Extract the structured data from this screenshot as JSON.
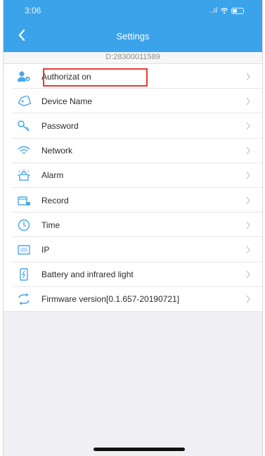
{
  "status_bar": {
    "time": "3:06",
    "signal": "..ıl"
  },
  "header": {
    "title": "Settings"
  },
  "device": {
    "id": "D:28300011589"
  },
  "settings": [
    {
      "label": "Authorizat on",
      "icon": "user-auth-icon"
    },
    {
      "label": "Device Name",
      "icon": "tag-icon"
    },
    {
      "label": "Password",
      "icon": "key-icon"
    },
    {
      "label": "Network",
      "icon": "wifi-icon"
    },
    {
      "label": "Alarm",
      "icon": "alarm-icon"
    },
    {
      "label": "Record",
      "icon": "record-icon"
    },
    {
      "label": "Time",
      "icon": "clock-icon"
    },
    {
      "label": "IP",
      "icon": "ip-icon"
    },
    {
      "label": "Battery and infrared light",
      "icon": "battery-icon"
    },
    {
      "label": "Firmware version[0.1.657-20190721]",
      "icon": "refresh-icon"
    }
  ],
  "colors": {
    "header_bg": "#3aa3ea",
    "icon": "#4aa8e8",
    "highlight": "#e53935"
  }
}
